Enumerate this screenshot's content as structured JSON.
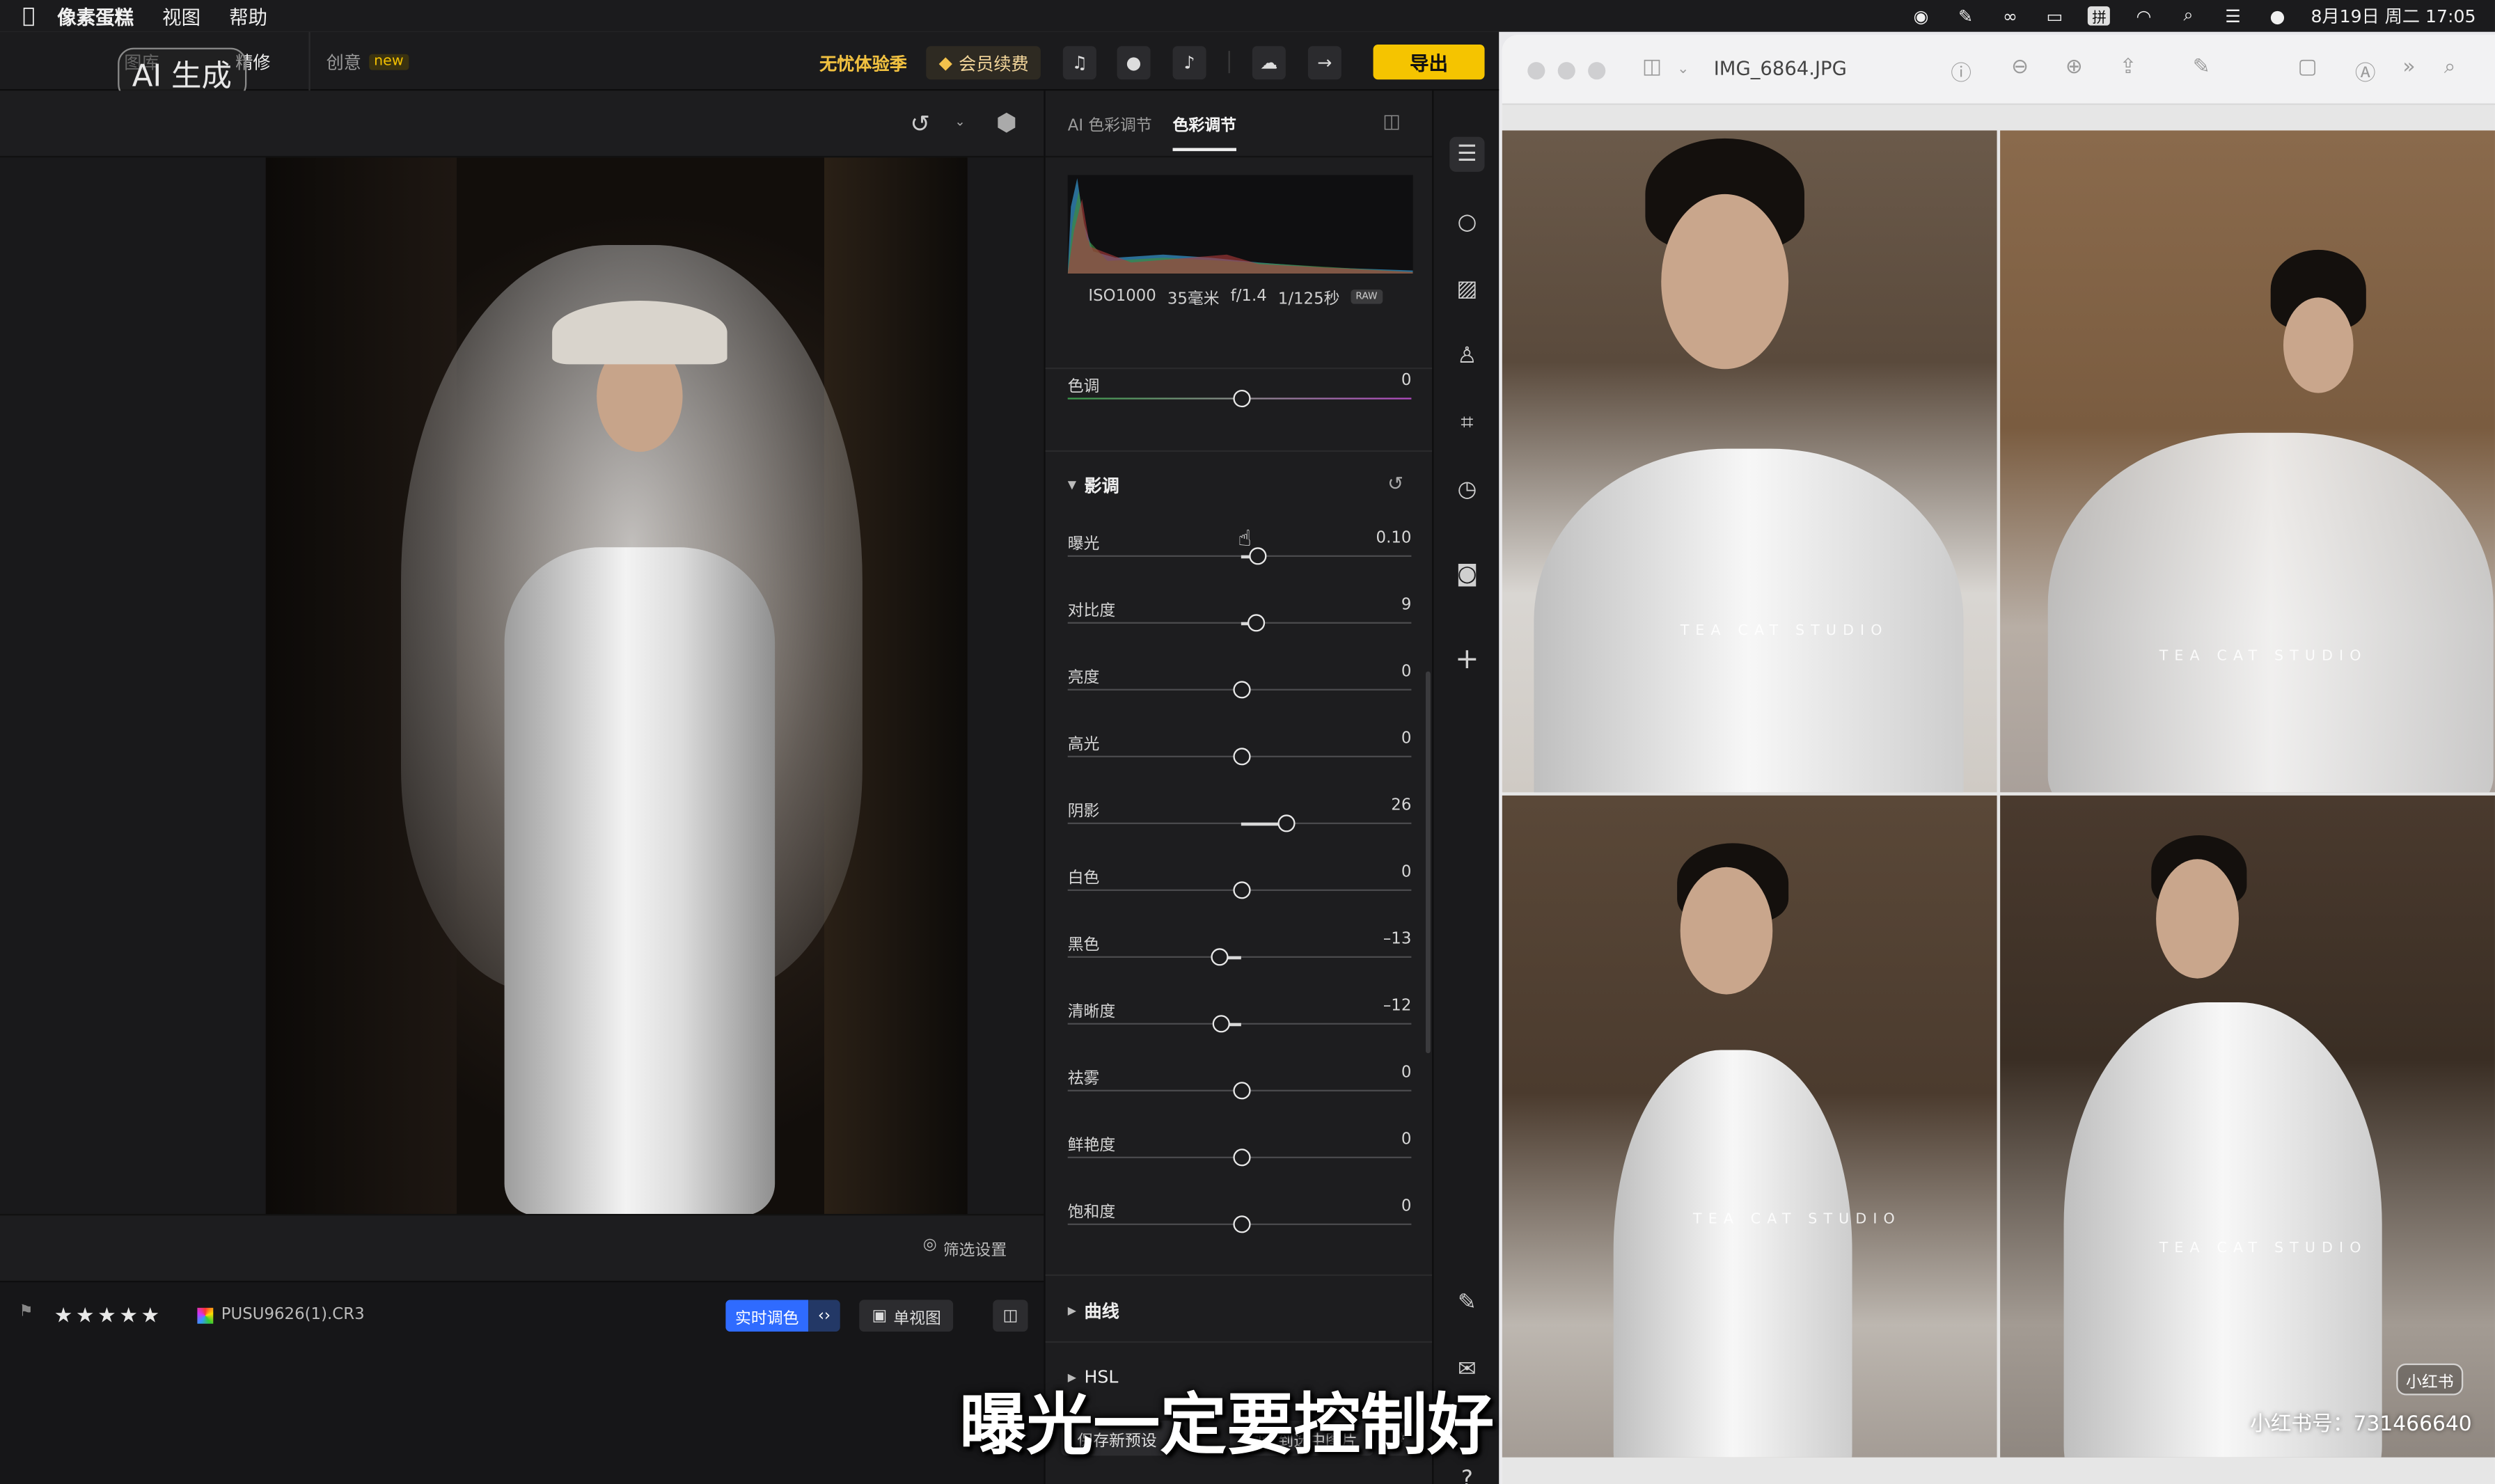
{
  "menubar": {
    "apple": "",
    "items": [
      "像素蛋糕",
      "视图",
      "帮助"
    ],
    "date_time": "8月19日 周二  17:05",
    "ime": "拼"
  },
  "app": {
    "tabs": {
      "tab1": "图库",
      "tab2": "精修",
      "creative": "创意",
      "new_tag": "new"
    },
    "ai_badge": "AI 生成",
    "promo": "无忧体验季",
    "member": "会员续费",
    "export": "导出",
    "filter_settings": "筛选设置",
    "file_name": "PUSU9626(1).CR3",
    "stars": "★★★★★",
    "live_adjust": "实时调色",
    "single_view": "单视图"
  },
  "panel": {
    "tab_ai": "AI 色彩调节",
    "tab_color": "色彩调节",
    "exif": {
      "iso": "ISO1000",
      "focal": "35毫米",
      "aperture": "f/1.4",
      "shutter": "1/125秒",
      "raw": "RAW"
    },
    "tint": {
      "label": "色调",
      "value": "0",
      "level": 0
    },
    "tone_section": "影调",
    "sliders": [
      {
        "label": "曝光",
        "value": "0.10",
        "level": 0.1
      },
      {
        "label": "对比度",
        "value": "9",
        "level": 9
      },
      {
        "label": "亮度",
        "value": "0",
        "level": 0
      },
      {
        "label": "高光",
        "value": "0",
        "level": 0
      },
      {
        "label": "阴影",
        "value": "26",
        "level": 26
      },
      {
        "label": "白色",
        "value": "0",
        "level": 0
      },
      {
        "label": "黑色",
        "value": "–13",
        "level": -13
      },
      {
        "label": "清晰度",
        "value": "–12",
        "level": -12
      },
      {
        "label": "祛雾",
        "value": "0",
        "level": 0
      },
      {
        "label": "鲜艳度",
        "value": "0",
        "level": 0
      },
      {
        "label": "饱和度",
        "value": "0",
        "level": 0
      }
    ],
    "curve_section": "曲线",
    "hsl_section": "HSL",
    "save_preset": "保存新预设",
    "sync": "同步到选中图片"
  },
  "preview": {
    "file_title": "IMG_6864.JPG",
    "watermark": "TEA CAT STUDIO"
  },
  "overlay": {
    "subtitle": "曝光一定要控制好",
    "xhs_logo": "小红书",
    "xhs_id": "小红书号：731466640"
  },
  "colors": {
    "accent_yellow": "#f5c400",
    "accent_blue": "#2f6bff"
  }
}
